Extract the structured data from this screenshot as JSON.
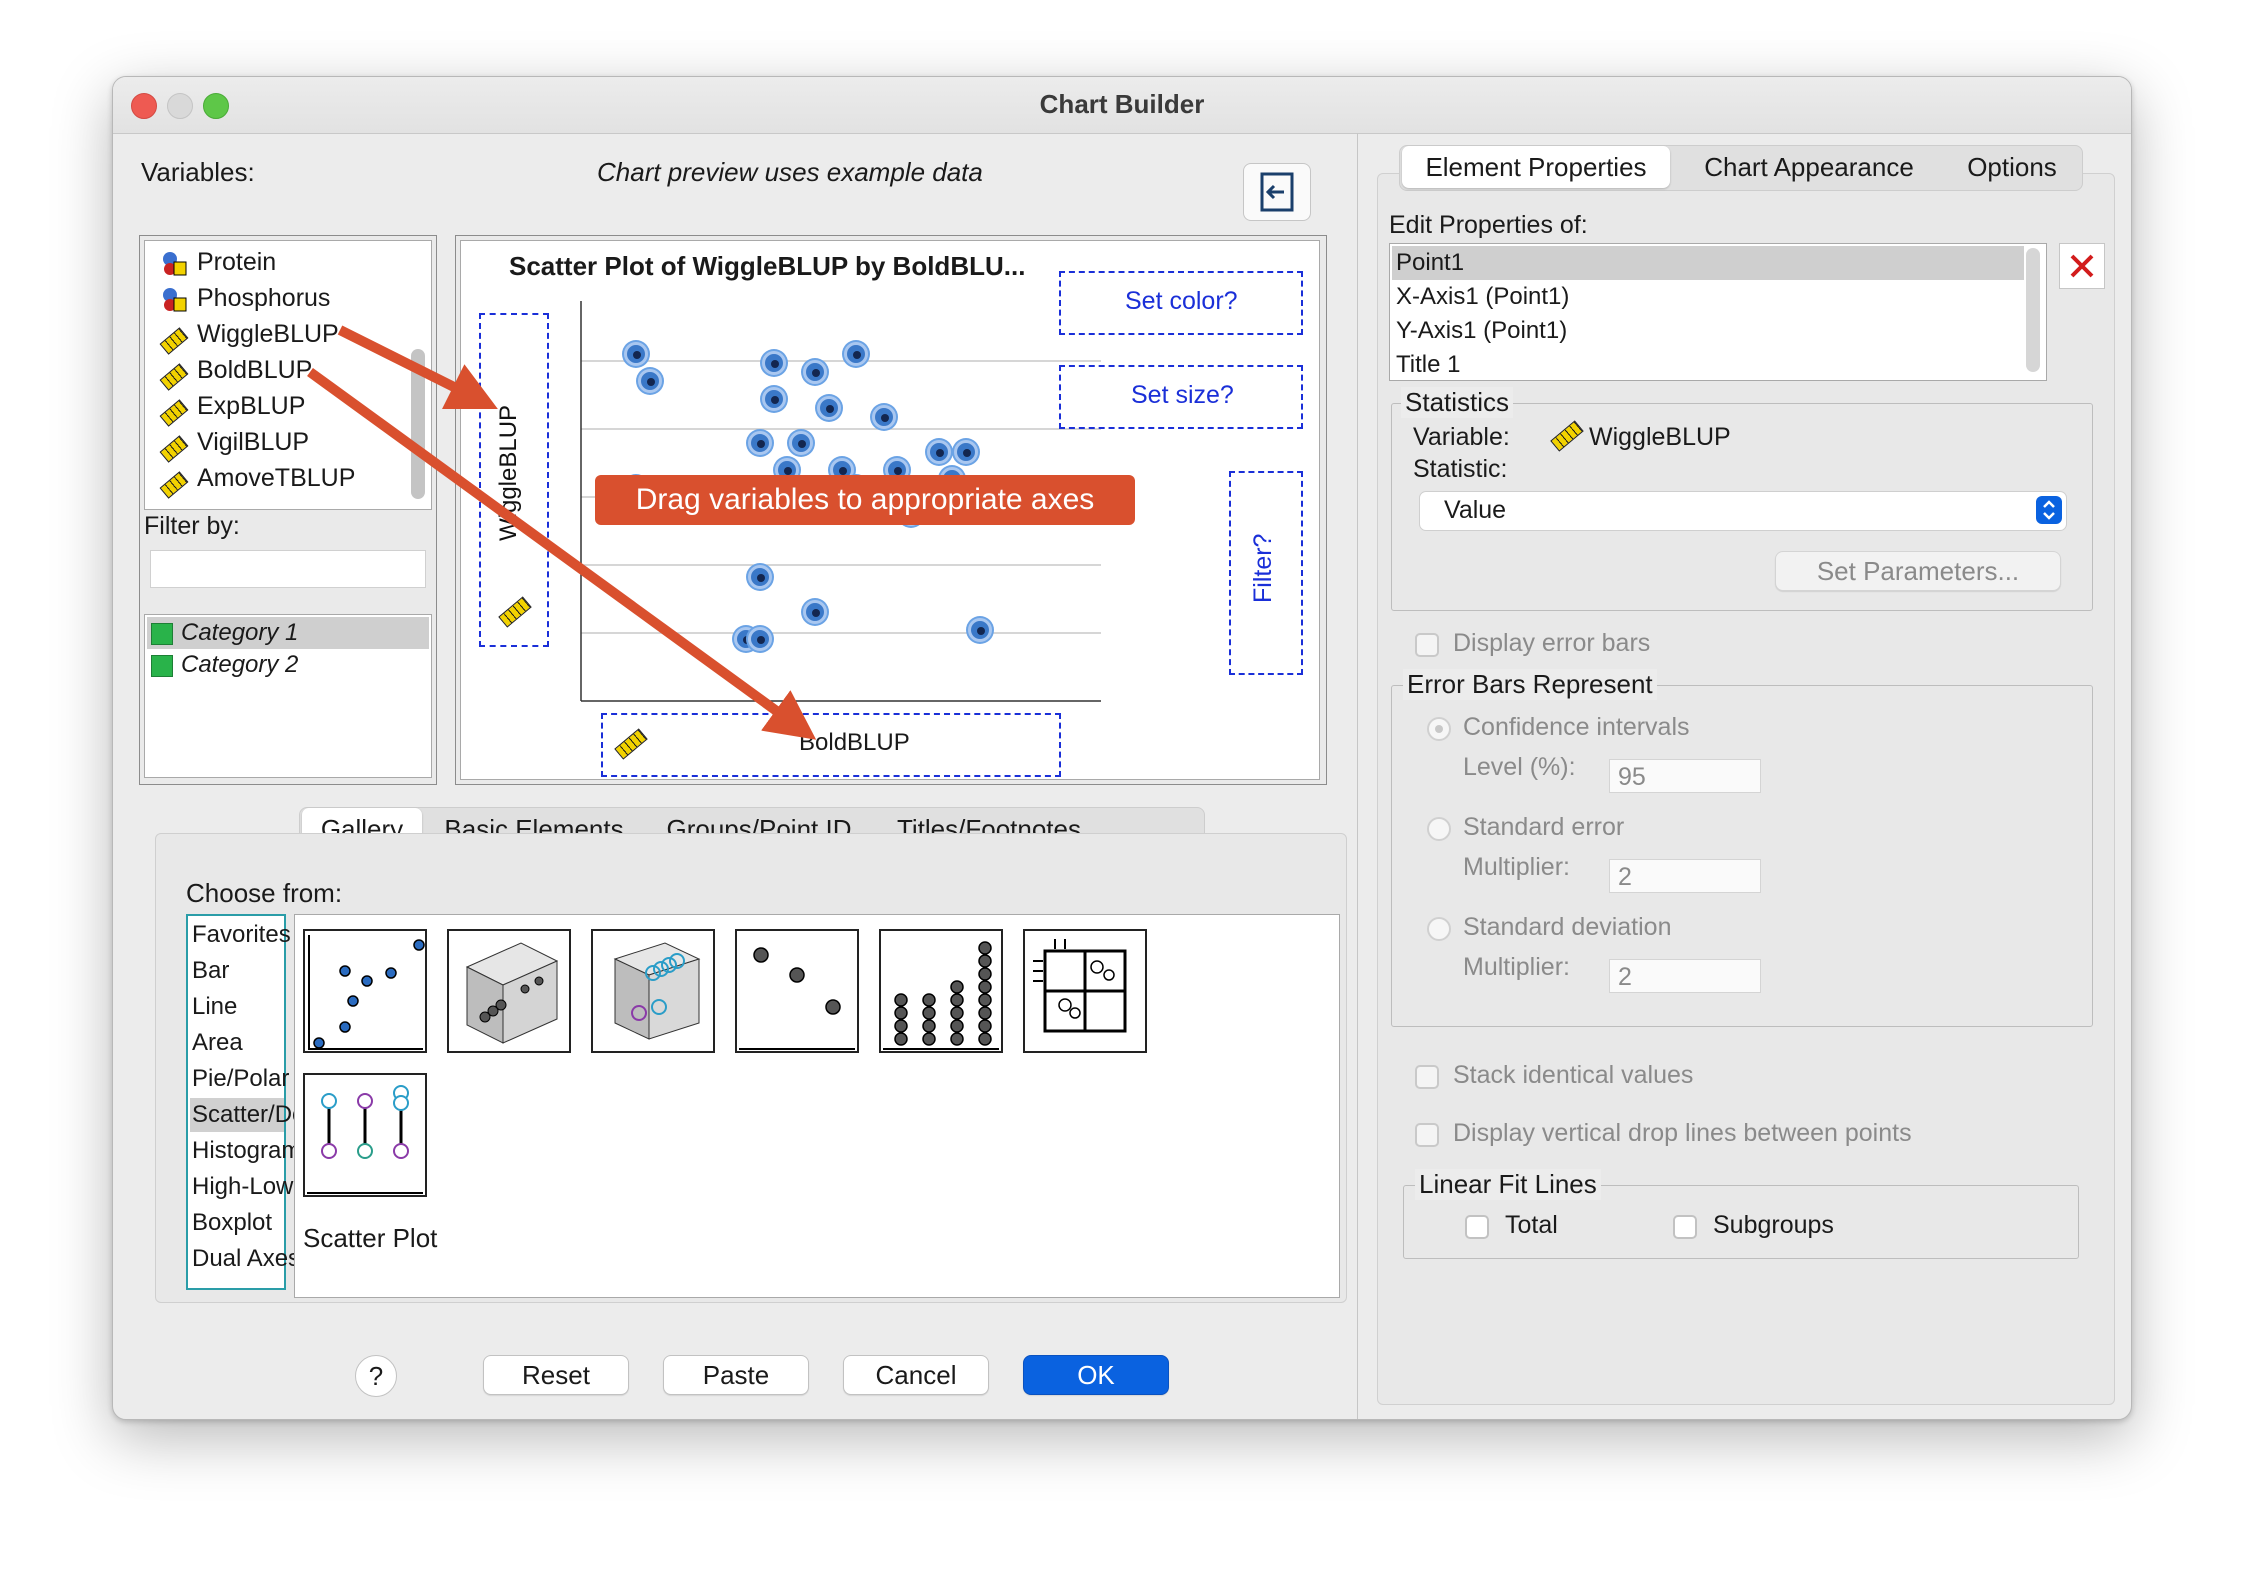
{
  "window": {
    "title": "Chart Builder"
  },
  "left": {
    "variables_label": "Variables:",
    "preview_note": "Chart preview uses example data",
    "variables": [
      {
        "name": "Protein",
        "icon": "nominal-icon"
      },
      {
        "name": "Phosphorus",
        "icon": "nominal-icon"
      },
      {
        "name": "WiggleBLUP",
        "icon": "scale-ruler-icon"
      },
      {
        "name": "BoldBLUP",
        "icon": "scale-ruler-icon"
      },
      {
        "name": "ExpBLUP",
        "icon": "scale-ruler-icon"
      },
      {
        "name": "VigilBLUP",
        "icon": "scale-ruler-icon"
      },
      {
        "name": "AmoveTBLUP",
        "icon": "scale-ruler-icon"
      }
    ],
    "filter_label": "Filter by:",
    "categories": [
      "Category 1",
      "Category 2"
    ]
  },
  "preview": {
    "title": "Scatter Plot of WiggleBLUP by BoldBLU...",
    "y_axis_var": "WiggleBLUP",
    "x_axis_var": "BoldBLUP",
    "set_color": "Set color?",
    "set_size": "Set size?",
    "filter": "Filter?",
    "callout": "Drag variables to appropriate axes"
  },
  "chart_data": {
    "type": "scatter",
    "title": "Scatter Plot of WiggleBLUP by BoldBLU...",
    "xlabel": "BoldBLUP",
    "ylabel": "WiggleBLUP",
    "points": [
      [
        4,
        78
      ],
      [
        5,
        72
      ],
      [
        4,
        48
      ],
      [
        14,
        76
      ],
      [
        17,
        74
      ],
      [
        20,
        78
      ],
      [
        14,
        68
      ],
      [
        18,
        66
      ],
      [
        22,
        64
      ],
      [
        13,
        58
      ],
      [
        16,
        58
      ],
      [
        15,
        52
      ],
      [
        19,
        52
      ],
      [
        23,
        52
      ],
      [
        26,
        56
      ],
      [
        28,
        56
      ],
      [
        15,
        44
      ],
      [
        20,
        48
      ],
      [
        24,
        42
      ],
      [
        27,
        50
      ],
      [
        13,
        28
      ],
      [
        12,
        14
      ],
      [
        13,
        14
      ],
      [
        17,
        20
      ],
      [
        29,
        16
      ]
    ]
  },
  "bottom_tabs": [
    "Gallery",
    "Basic Elements",
    "Groups/Point ID",
    "Titles/Footnotes"
  ],
  "gallery": {
    "choose_label": "Choose from:",
    "types": [
      "Favorites",
      "Bar",
      "Line",
      "Area",
      "Pie/Polar",
      "Scatter/Dot",
      "Histogram",
      "High-Low",
      "Boxplot",
      "Dual Axes"
    ],
    "selected": "Scatter/Dot",
    "selected_thumb_label": "Scatter Plot"
  },
  "buttons": {
    "help": "?",
    "reset": "Reset",
    "paste": "Paste",
    "cancel": "Cancel",
    "ok": "OK"
  },
  "right": {
    "tabs": [
      "Element Properties",
      "Chart Appearance",
      "Options"
    ],
    "edit_props_label": "Edit Properties of:",
    "edit_items": [
      "Point1",
      "X-Axis1 (Point1)",
      "Y-Axis1 (Point1)",
      "Title 1"
    ],
    "statistics": {
      "title": "Statistics",
      "variable_label": "Variable:",
      "variable_value": "WiggleBLUP",
      "statistic_label": "Statistic:",
      "statistic_value": "Value",
      "set_params": "Set Parameters..."
    },
    "display_error_bars": "Display error bars",
    "error_bars": {
      "title": "Error Bars Represent",
      "ci": "Confidence intervals",
      "level_label": "Level (%):",
      "level_value": "95",
      "se": "Standard error",
      "se_mult_label": "Multiplier:",
      "se_mult_value": "2",
      "sd": "Standard deviation",
      "sd_mult_label": "Multiplier:",
      "sd_mult_value": "2"
    },
    "stack_identical": "Stack identical values",
    "drop_lines": "Display vertical drop lines between points",
    "linear_fit": {
      "title": "Linear Fit Lines",
      "total": "Total",
      "subgroups": "Subgroups"
    }
  },
  "colors": {
    "accent": "#0a62e0",
    "callout": "#d9502e",
    "drop_zone": "#1a2fd8"
  }
}
